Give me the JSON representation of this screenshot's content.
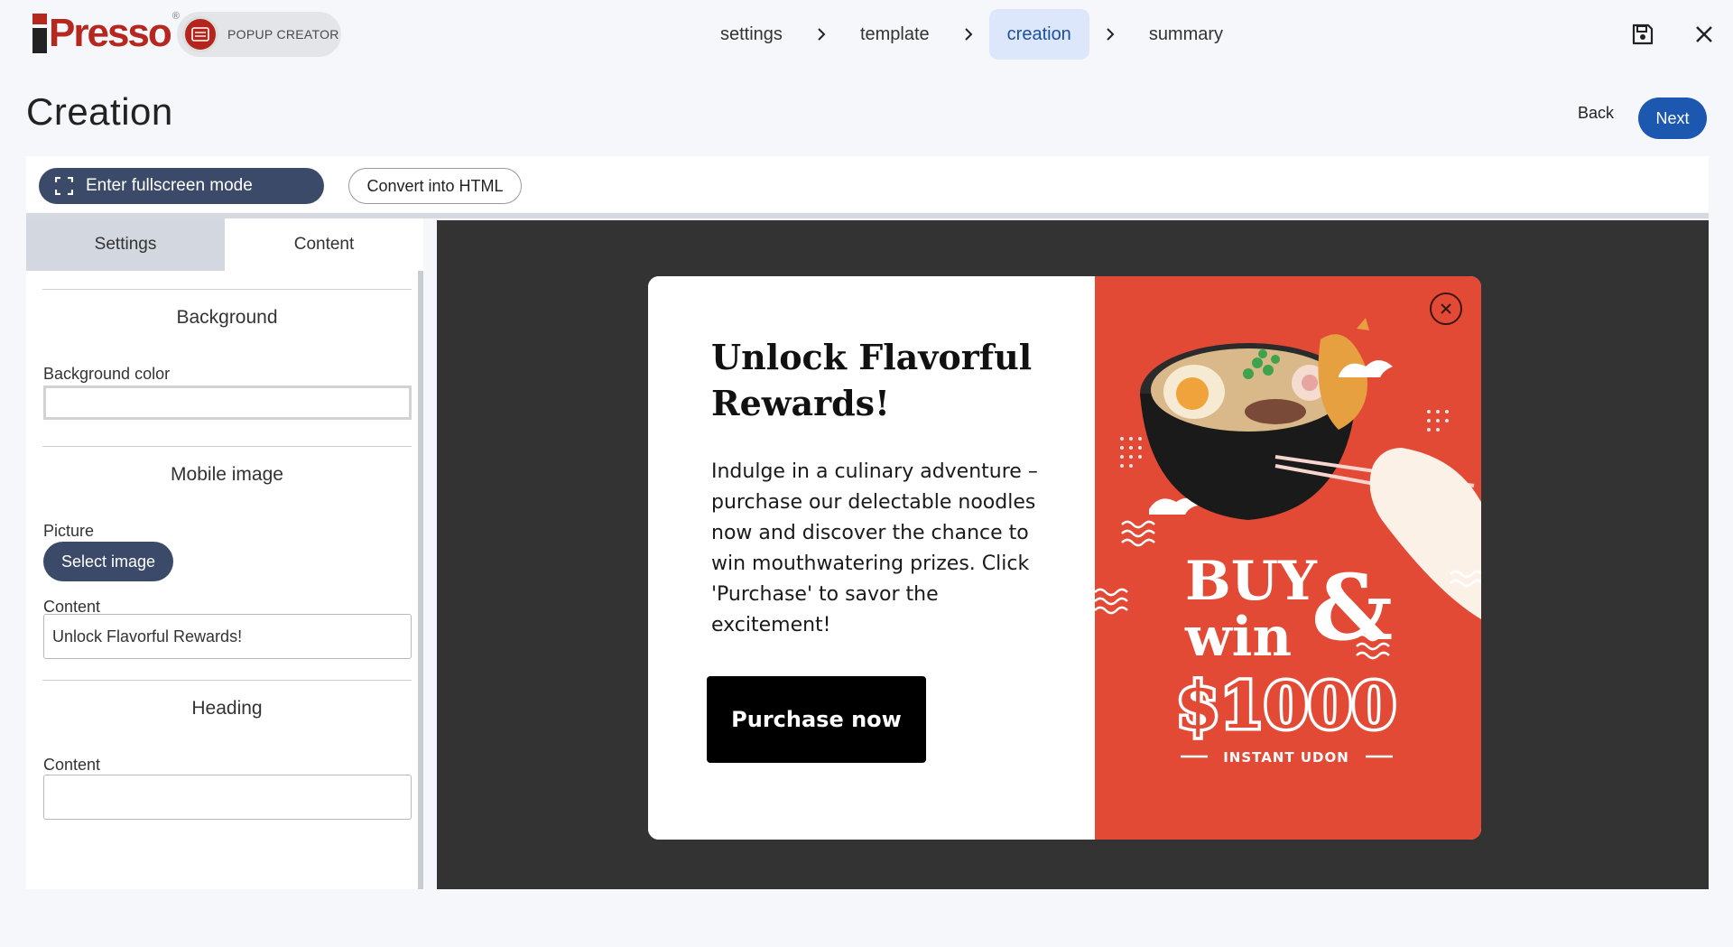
{
  "header": {
    "logo": "iPresso",
    "logo_reg": "®",
    "app_name": "POPUP CREATOR",
    "steps": [
      {
        "label": "settings",
        "active": false
      },
      {
        "label": "template",
        "active": false
      },
      {
        "label": "creation",
        "active": true
      },
      {
        "label": "summary",
        "active": false
      }
    ],
    "save_icon": "save-icon",
    "close_icon": "close-icon"
  },
  "page": {
    "title": "Creation",
    "back_label": "Back",
    "next_label": "Next"
  },
  "toolbar": {
    "fullscreen_label": "Enter fullscreen mode",
    "convert_label": "Convert into HTML"
  },
  "sidebar": {
    "tabs": [
      {
        "label": "Settings",
        "active": false
      },
      {
        "label": "Content",
        "active": true
      }
    ],
    "sections": {
      "background": {
        "title": "Background",
        "color_label": "Background color",
        "color_value": ""
      },
      "mobile_image": {
        "title": "Mobile image",
        "picture_label": "Picture",
        "select_label": "Select image",
        "content_label": "Content",
        "content_value": "Unlock Flavorful Rewards!"
      },
      "heading": {
        "title": "Heading",
        "content_label": "Content"
      }
    }
  },
  "popup": {
    "heading": "Unlock Flavorful Rewards!",
    "body": "Indulge in a culinary adventure – purchase our delectable noodles now and discover the chance to win mouthwatering prizes. Click 'Purchase' to savor the excitement!",
    "button_label": "Purchase now",
    "promo": {
      "line1": "BUY",
      "amp": "&",
      "line2": "win",
      "amount": "$1000",
      "brand": "INSTANT UDON"
    },
    "colors": {
      "promo_bg": "#e34a36",
      "button_bg": "#000000"
    }
  },
  "colors": {
    "accent": "#1d58b0",
    "dark_button": "#3c4a6a",
    "active_step_bg": "#dce7fb",
    "logo_red": "#b5271f",
    "canvas_bg": "#333333"
  }
}
